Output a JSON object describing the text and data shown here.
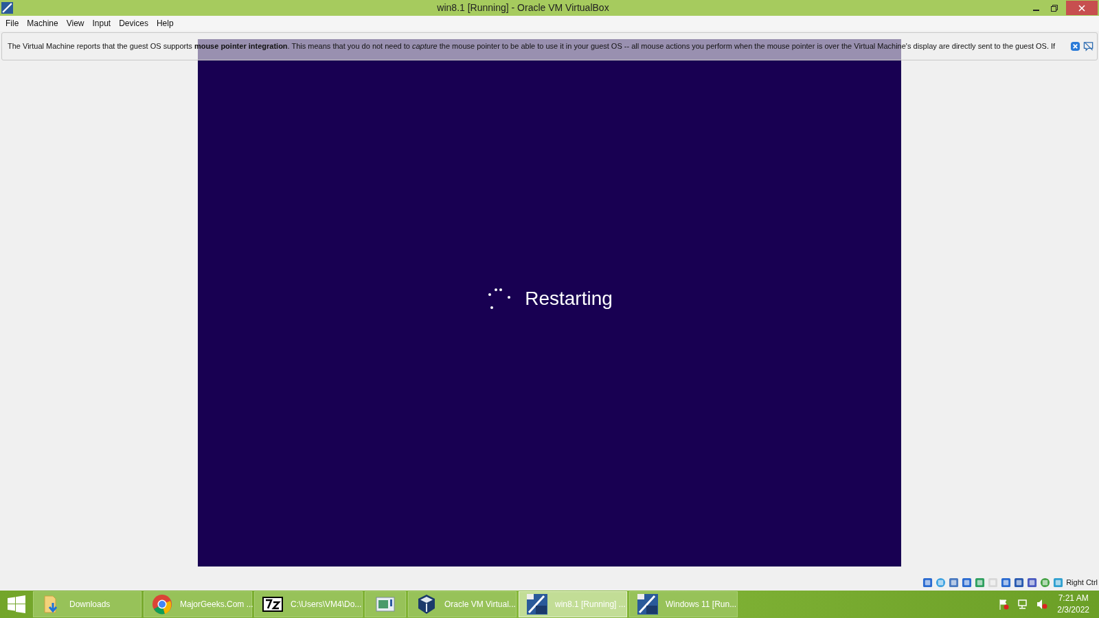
{
  "window": {
    "title": "win8.1 [Running] - Oracle VM VirtualBox"
  },
  "menu": [
    "File",
    "Machine",
    "View",
    "Input",
    "Devices",
    "Help"
  ],
  "notice": {
    "text": "The Virtual Machine reports that the guest OS supports **mouse pointer integration**. This means that you do not need to *capture* the mouse pointer to be able to use it in your guest OS -- all mouse actions you perform when the mouse pointer is over the Virtual Machine's display are directly sent to the guest OS. If"
  },
  "guest_screen": {
    "status": "Restarting"
  },
  "status_bar": {
    "host_key": "Right Ctrl"
  },
  "taskbar": {
    "items": [
      {
        "label": "Downloads",
        "selected": false
      },
      {
        "label": "MajorGeeks.Com ...",
        "selected": false
      },
      {
        "label": "C:\\Users\\VM4\\Do...",
        "selected": false
      },
      {
        "selected": false
      },
      {
        "label": "Oracle VM Virtual...",
        "selected": false
      },
      {
        "label": "win8.1 [Running] ...",
        "selected": true
      },
      {
        "label": "Windows 11 [Run...",
        "selected": false
      }
    ],
    "clock": {
      "time": "7:21 AM",
      "date": "2/3/2022"
    }
  }
}
